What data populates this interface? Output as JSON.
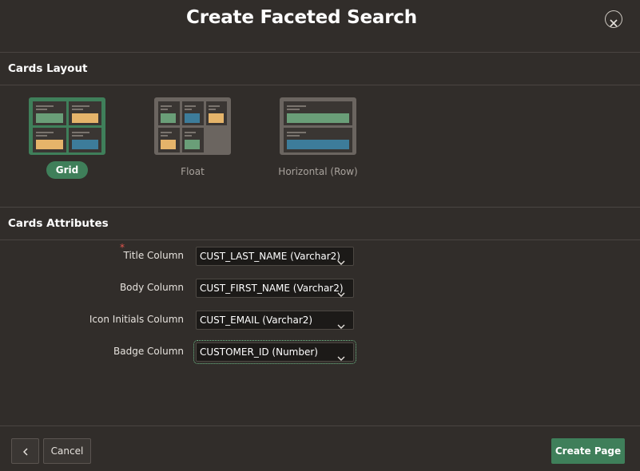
{
  "dialog": {
    "title": "Create Faceted Search"
  },
  "cards_layout": {
    "heading": "Cards Layout",
    "options": [
      {
        "label": "Grid",
        "selected": true
      },
      {
        "label": "Float",
        "selected": false
      },
      {
        "label": "Horizontal (Row)",
        "selected": false
      }
    ]
  },
  "cards_attributes": {
    "heading": "Cards Attributes",
    "fields": [
      {
        "label": "Title Column",
        "required": true,
        "value": "CUST_LAST_NAME (Varchar2)"
      },
      {
        "label": "Body Column",
        "required": false,
        "value": "CUST_FIRST_NAME (Varchar2)"
      },
      {
        "label": "Icon Initials Column",
        "required": false,
        "value": "CUST_EMAIL (Varchar2)"
      },
      {
        "label": "Badge Column",
        "required": false,
        "value": "CUSTOMER_ID (Number)"
      }
    ]
  },
  "footer": {
    "cancel_label": "Cancel",
    "create_label": "Create Page"
  },
  "colors": {
    "background": "#312d2a",
    "accent_green": "#3f7f5a",
    "card_green": "#6a9e78",
    "card_orange": "#e5b46a",
    "card_blue": "#3d7c9a"
  }
}
